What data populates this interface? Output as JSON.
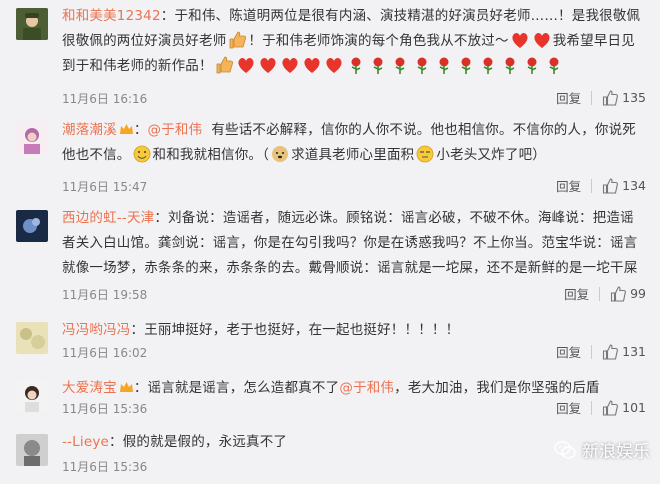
{
  "comments": [
    {
      "user": "和和美美12342",
      "parts": [
        "：于和伟、陈道明两位是很有内涵、演技精湛的好演员好老师……！是我很敬佩很敬佩的两位好演员好老师",
        "！于和伟老师饰演的每个角色我从不放过～",
        "我希望早日见到于和伟老师的新作品！"
      ],
      "time": "11月6日 16:16",
      "reply": "回复",
      "likes": "135"
    },
    {
      "user": "潮落潮溪",
      "mention": "@于和伟",
      "text": "有些话不必解释，信你的人你不说。他也相信你。不信你的人，你说死他也不信。",
      "text2": "和和我就相信你。（",
      "text3": "求道具老师心里面积",
      "text4": "小老头又炸了吧）",
      "time": "11月6日 15:47",
      "reply": "回复",
      "likes": "134"
    },
    {
      "user": "西边的虹--天津",
      "text": "：刘备说：造谣者，随远必诛。顾铭说：谣言必破，不破不休。海峰说：把造谣者关入白山馆。龚剑说：谣言，你是在勾引我吗？你是在诱惑我吗？不上你当。范宝华说：谣言就像一场梦，赤条条的来，赤条条的去。戴骨顺说：谣言就是一坨屎，还不是新鲜的是一坨干屎",
      "time": "11月6日 19:58",
      "reply": "回复",
      "likes": "99"
    },
    {
      "user": "冯冯哟冯冯",
      "text": "：王丽坤挺好，老于也挺好，在一起也挺好！！！！！",
      "time": "11月6日 16:02",
      "reply": "回复",
      "likes": "131"
    },
    {
      "user": "大爱涛宝",
      "text": "：谣言就是谣言，怎么造都真不了",
      "mention": "@于和伟",
      "text2": "，老大加油，我们是你坚强的后盾",
      "time": "11月6日 15:36",
      "reply": "回复",
      "likes": "101"
    },
    {
      "user": "--Lieye",
      "text": "：假的就是假的，永远真不了",
      "time": "11月6日 15:36"
    }
  ],
  "watermark": "新浪娱乐",
  "colors": {
    "username": "#eb7350",
    "background": "#f2f2f5"
  }
}
